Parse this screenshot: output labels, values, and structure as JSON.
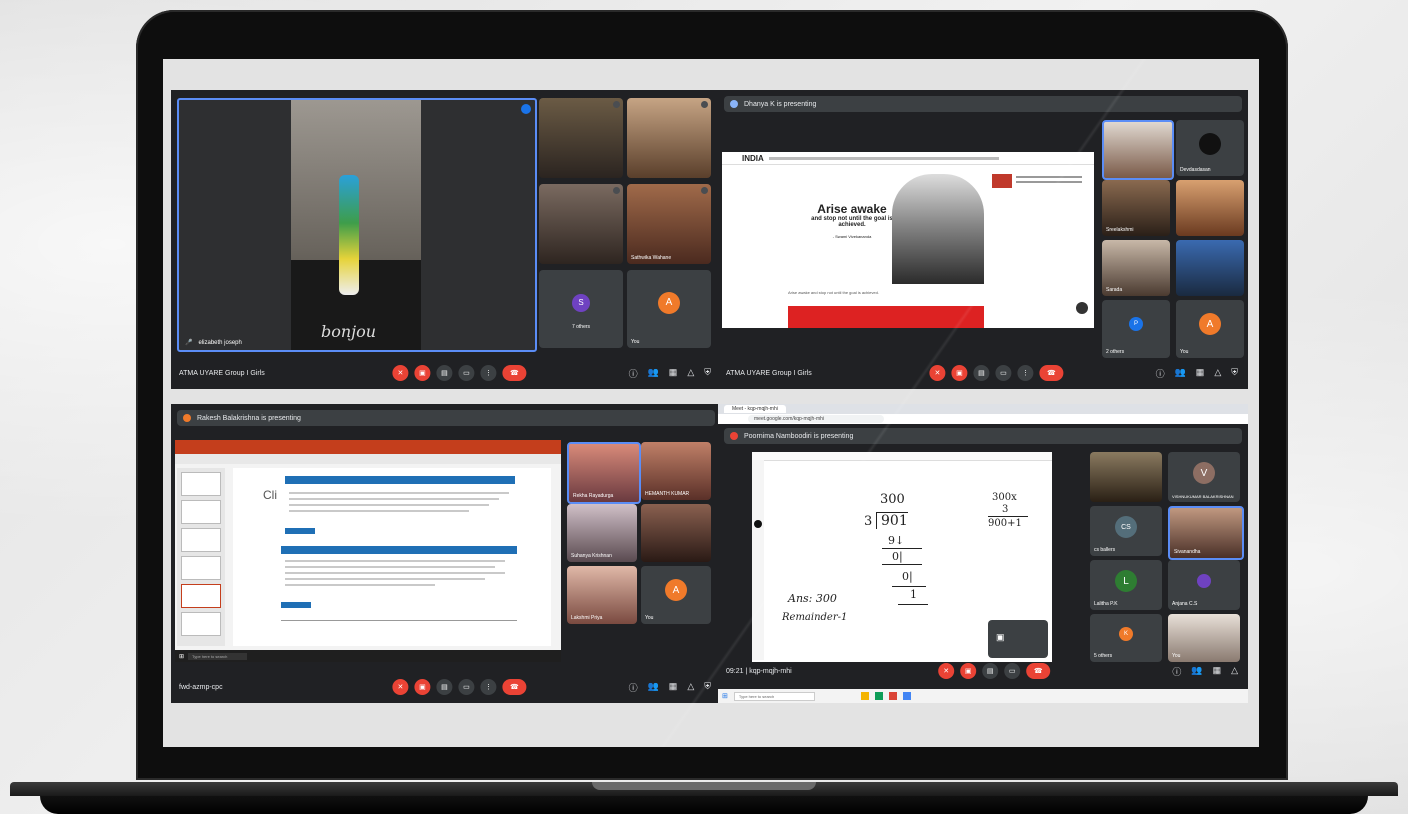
{
  "colors": {
    "accent": "#1a73e8",
    "end_call": "#ea4335",
    "orange_avatar": "#f07a2a",
    "purple_avatar": "#6f42c1",
    "panel_bg": "#202124",
    "tile_bg": "#3c4043"
  },
  "panel1": {
    "main_name": "elizabeth joseph",
    "shirt_text": "bonjou",
    "meeting": "ATMA UYARE Group I Girls",
    "tiles": [
      {
        "name": ""
      },
      {
        "name": ""
      },
      {
        "name": ""
      },
      {
        "name": "Sathwika Wahane"
      },
      {
        "name": "7 others",
        "avatar": "S"
      },
      {
        "name": "You",
        "avatar": "A"
      }
    ]
  },
  "panel2": {
    "presenting": "Dhanya K is presenting",
    "site_logo": "INDIA",
    "quote_title": "Arise awake",
    "quote_line1": "and stop not until the goal is",
    "quote_line2": "achieved.",
    "quote_author": "- Swami Vivekananda",
    "caption": "Arise awake and stop not until the goal is achieved.",
    "meeting": "ATMA UYARE Group I Girls",
    "tiles": [
      {
        "name": ""
      },
      {
        "name": "Devdasdasan",
        "avatar": ""
      },
      {
        "name": "Sreelakshmi"
      },
      {
        "name": ""
      },
      {
        "name": "Sarada"
      },
      {
        "name": ""
      },
      {
        "name": "2 others",
        "avatar": "P"
      },
      {
        "name": "You",
        "avatar": "A"
      }
    ]
  },
  "panel3": {
    "presenting": "Rakesh Balakrishna is presenting",
    "slide_title": "Cli",
    "meeting": "fwd-azmp-cpc",
    "taskbar_search": "Type here to search",
    "tiles": [
      {
        "name": "Rekha Rayadurga"
      },
      {
        "name": "HEMANTH KUMAR"
      },
      {
        "name": "Suhanya Krishnan"
      },
      {
        "name": ""
      },
      {
        "name": "Lakshmi Priya"
      },
      {
        "name": "You",
        "avatar": "A"
      }
    ]
  },
  "panel4": {
    "browser_tab": "Meet - kqp-mqjh-mhi",
    "url": "meet.google.com/kqp-mqjh-mhi",
    "presenting": "Poornima Namboodiri is presenting",
    "math": {
      "top": "300",
      "divisor": "3",
      "dividend": "901",
      "lines": [
        "9↓",
        "0|",
        "0|"
      ],
      "remainder_digits": "1",
      "answer": "Ans: 300",
      "remainder_label": "Remainder-1",
      "right_top": "300x",
      "right_mult": "3",
      "right_result": "900+1"
    },
    "meeting": "kqp-mqjh-mhi",
    "time": "09:21",
    "taskbar_search": "Type here to search",
    "tiles": [
      {
        "name": ""
      },
      {
        "name": "VISHNUKUMAR BALAKRISHNAN",
        "avatar": "V"
      },
      {
        "name": "cs ballers",
        "avatar": "CS"
      },
      {
        "name": "Sivanandha"
      },
      {
        "name": "Lalitha P.K",
        "avatar": "L"
      },
      {
        "name": "Anjana C.S"
      },
      {
        "name": "5 others",
        "avatar": "K"
      },
      {
        "name": "You"
      }
    ]
  }
}
